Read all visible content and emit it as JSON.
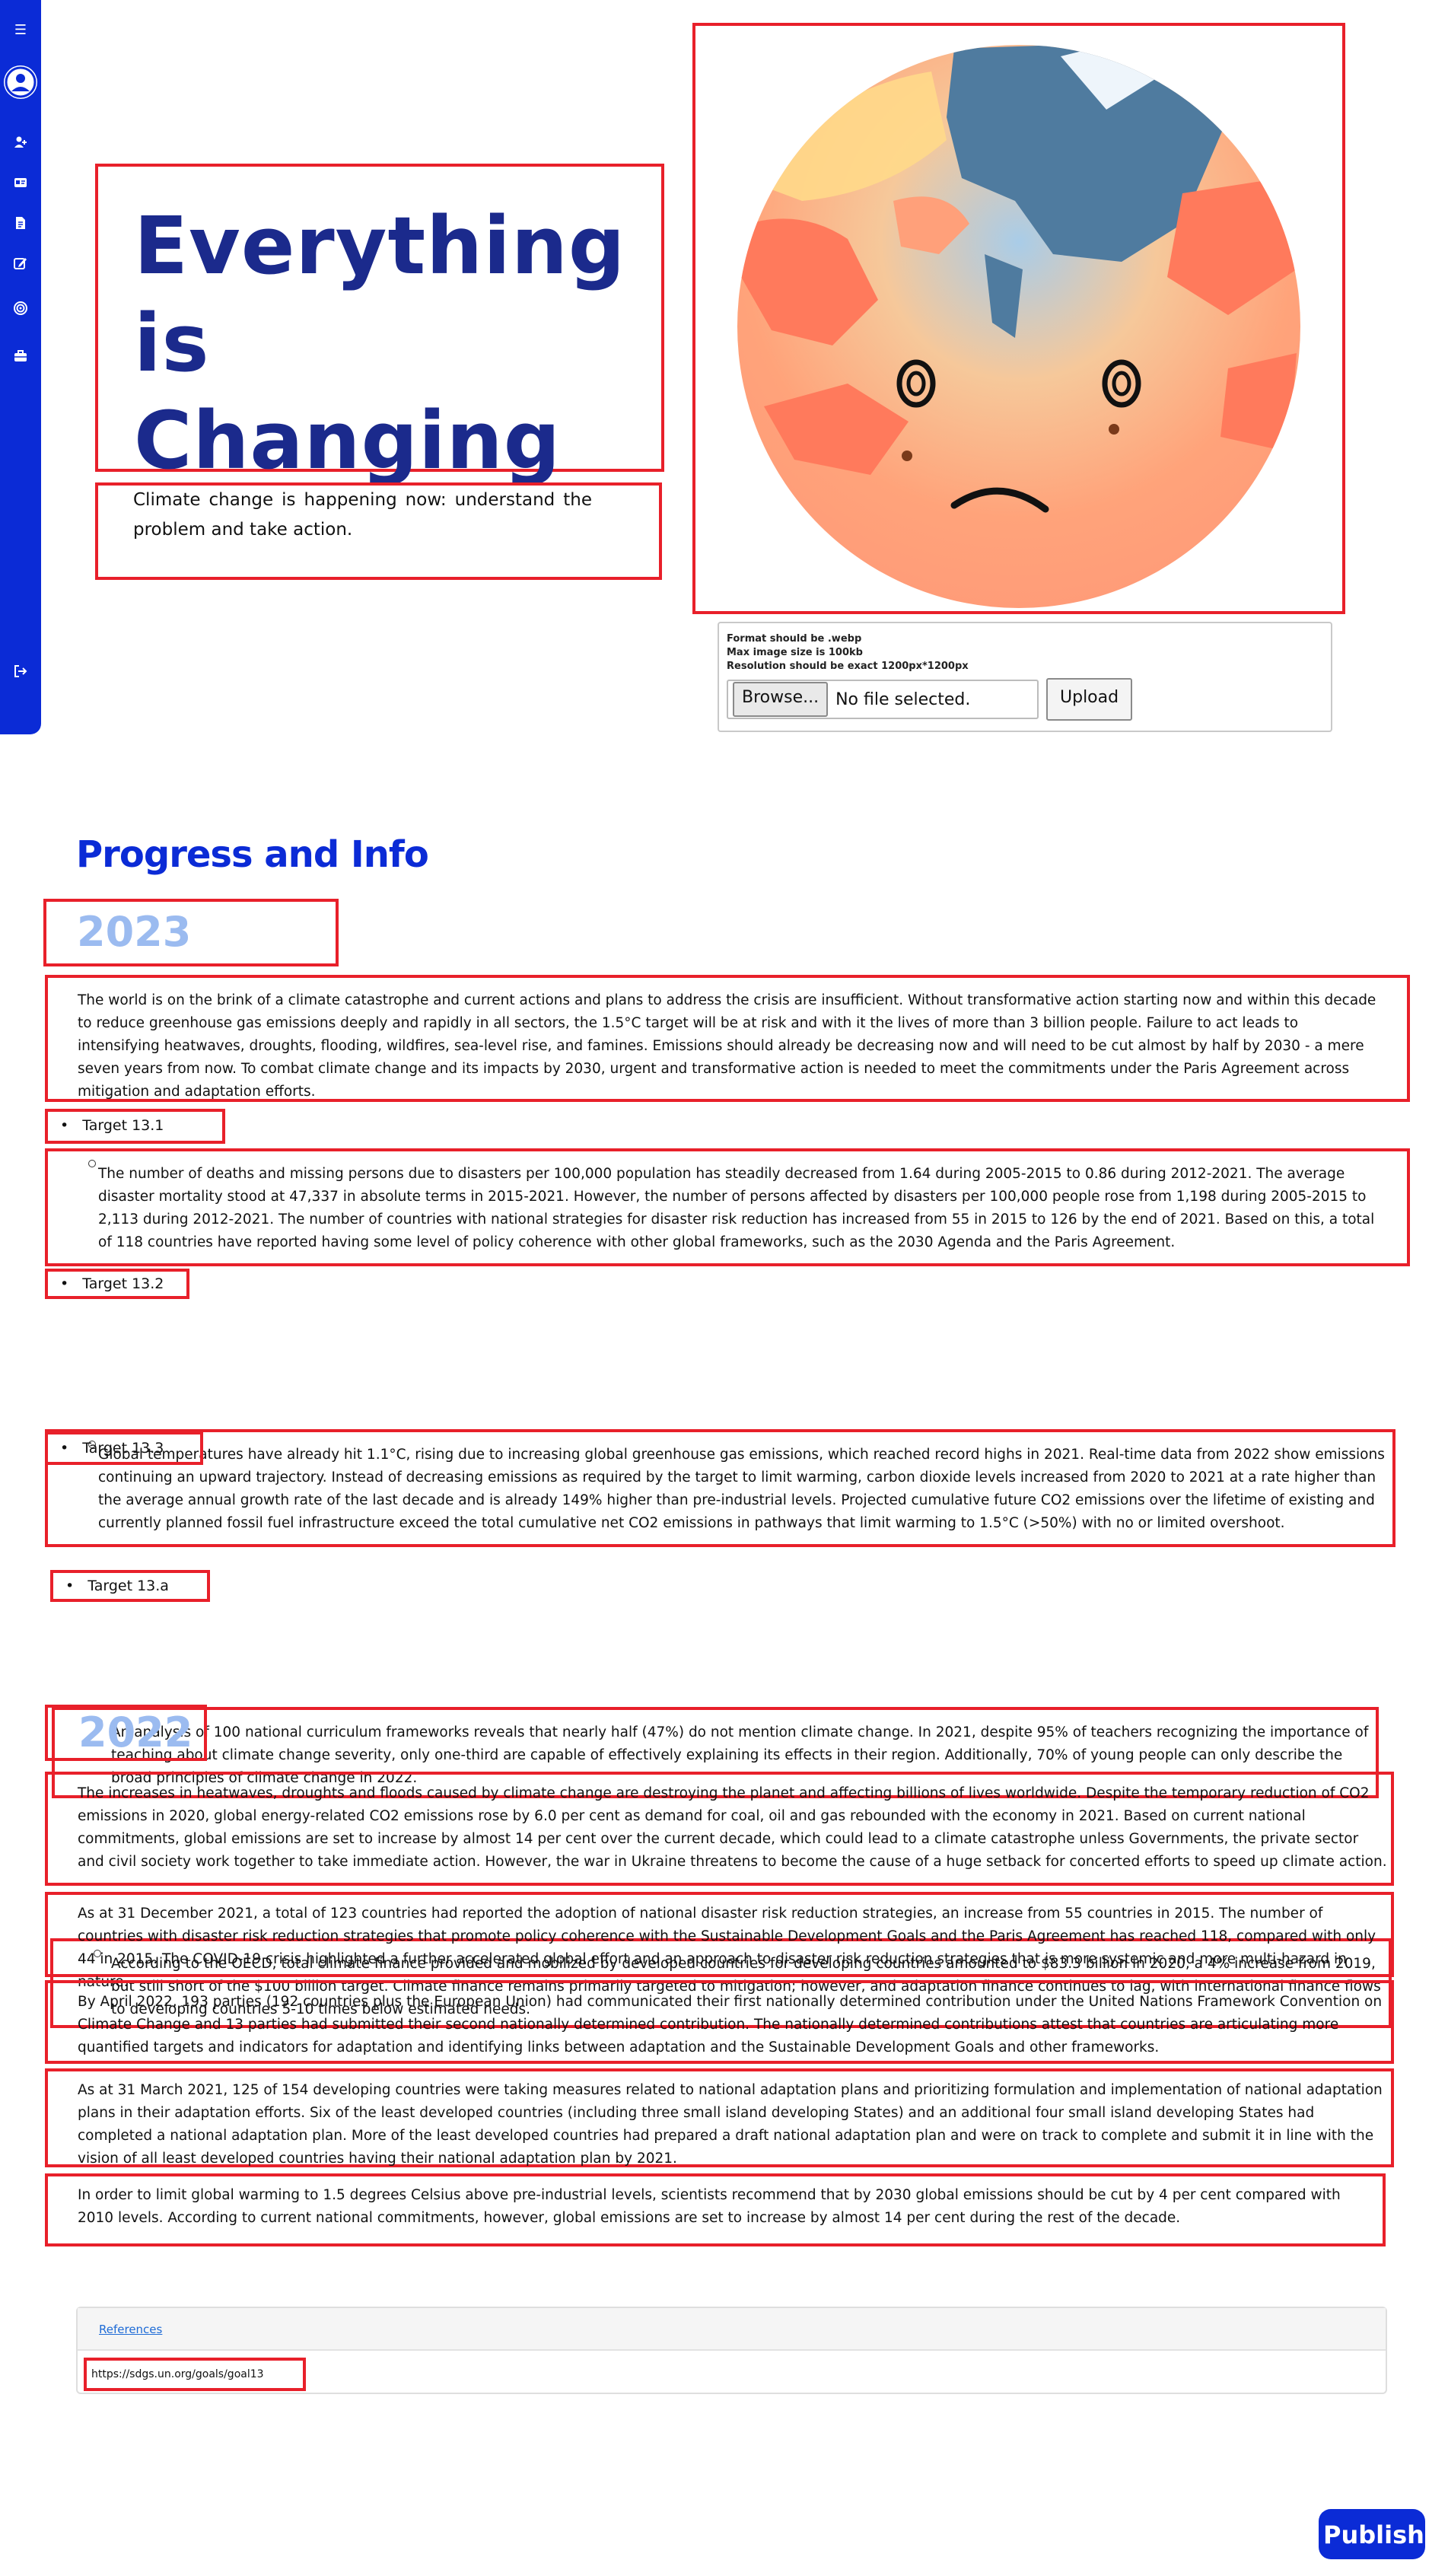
{
  "hero": {
    "title_lines": [
      "Everything",
      "is",
      "Changing"
    ],
    "subtitle": "Climate change is happening now: understand the problem and take action."
  },
  "upload": {
    "notes": [
      "Format should be .webp",
      "Max image size is 100kb",
      "Resolution should be exact 1200px*1200px"
    ],
    "browse_label": "Browse...",
    "file_status": "No file selected.",
    "upload_label": "Upload"
  },
  "sidebar": {
    "icons": [
      "menu-icon",
      "user-avatar-icon",
      "add-user-icon",
      "id-card-icon",
      "document-icon",
      "edit-icon",
      "target-icon",
      "briefcase-icon",
      "logout-icon"
    ]
  },
  "section": {
    "heading": "Progress and Info",
    "y2023": {
      "year": "2023",
      "intro": "The world is on the brink of a climate catastrophe and current actions and plans to address the crisis are insufficient. Without transformative action starting now and within this decade to reduce greenhouse gas emissions deeply and rapidly in all sectors, the 1.5°C target will be at risk and with it the lives of more than 3 billion people. Failure to act leads to intensifying heatwaves, droughts, flooding, wildfires, sea-level rise, and famines. Emissions should already be decreasing now and will need to be cut almost by half by 2030 - a mere seven years from now. To combat climate change and its impacts by 2030, urgent and transformative action is needed to meet the commitments under the Paris Agreement across mitigation and adaptation efforts.",
      "targets": [
        {
          "label": "Target 13.1",
          "text": "The number of deaths and missing persons due to disasters per 100,000 population has steadily decreased from 1.64 during 2005-2015 to 0.86 during 2012-2021. The average disaster mortality stood at 47,337 in absolute terms in 2015-2021. However, the number of persons affected by disasters per 100,000 people rose from 1,198 during 2005-2015 to 2,113 during 2012-2021. The number of countries with national strategies for disaster risk reduction has increased from 55 in 2015 to 126 by the end of 2021. Based on this, a total of 118 countries have reported having some level of policy coherence with other global frameworks, such as the 2030 Agenda and the Paris Agreement."
        },
        {
          "label": "Target 13.2",
          "text": "Global temperatures have already hit 1.1°C, rising due to increasing global greenhouse gas emissions, which reached record highs in 2021. Real-time data from 2022 show emissions continuing an upward trajectory. Instead of decreasing emissions as required by the target to limit warming, carbon dioxide levels increased from 2020 to 2021 at a rate higher than the average annual growth rate of the last decade and is already 149% higher than pre-industrial levels. Projected cumulative future CO2 emissions over the lifetime of existing and currently planned fossil fuel infrastructure exceed the total cumulative net CO2 emissions in pathways that limit warming to 1.5°C (>50%) with no or limited overshoot."
        },
        {
          "label": "Target 13.3",
          "text": "An analysis of 100 national curriculum frameworks reveals that nearly half (47%) do not mention climate change. In 2021, despite 95% of teachers recognizing the importance of teaching about climate change severity, only one-third are capable of effectively explaining its effects in their region. Additionally, 70% of young people can only describe the broad principles of climate change in 2022."
        },
        {
          "label": "Target 13.a",
          "text": "According to the OECD, total climate finance provided and mobilized by developed countries for developing countries amounted to $83.3 billion in 2020, a 4% increase from 2019, but still short of the $100 billion target. Climate finance remains primarily targeted to mitigation; however, and adaptation finance continues to lag, with international finance flows to developing countries 5-10 times below estimated needs."
        }
      ]
    },
    "y2022": {
      "year": "2022",
      "paragraphs": [
        "The increases in heatwaves, droughts and floods caused by climate change are destroying the planet and affecting billions of lives worldwide. Despite the temporary reduction of CO2 emissions in 2020, global energy-related CO2 emissions rose by 6.0 per cent as demand for coal, oil and gas rebounded with the economy in 2021. Based on current national commitments, global emissions are set to increase by almost 14 per cent over the current decade, which could lead to a climate catastrophe unless Governments, the private sector and civil society work together to take immediate action. However, the war in Ukraine threatens to become the cause of a huge setback for concerted efforts to speed up climate action.",
        "As at 31 December 2021, a total of 123 countries had reported the adoption of national disaster risk reduction strategies, an increase from 55 countries in 2015. The number of countries with disaster risk reduction strategies that promote policy coherence with the Sustainable Development Goals and the Paris Agreement has reached 118, compared with only 44 in 2015. The COVID-19 crisis highlighted a further accelerated global effort and an approach to disaster risk reduction strategies that is more systemic and more multi-hazard in nature.",
        "By April 2022, 193 parties (192 countries plus the European Union) had communicated their first nationally determined contribution under the United Nations Framework Convention on Climate Change and 13 parties had submitted their second nationally determined contribution. The nationally determined contributions attest that countries are articulating more quantified targets and indicators for adaptation and identifying links between adaptation and the Sustainable Development Goals and other frameworks.",
        "As at 31 March 2021, 125 of 154 developing countries were taking measures related to national adaptation plans and prioritizing formulation and implementation of national adaptation plans in their adaptation efforts. Six of the least developed countries (including three small island developing States) and an additional four small island developing States had completed a national adaptation plan. More of the least developed countries had prepared a draft national adaptation plan and were on track to complete and submit it in line with the vision of all least developed countries having their national adaptation plan by 2021.",
        "In order to limit global warming to 1.5 degrees Celsius above pre-industrial levels, scientists recommend that by 2030 global emissions should be cut by 4 per cent compared with 2010 levels. According to current national commitments, however, global emissions are set to increase by almost 14 per cent during the rest of the decade."
      ]
    }
  },
  "references": {
    "header": "References",
    "link": "https://sdgs.un.org/goals/goal13"
  },
  "publish_label": "Publish",
  "colors": {
    "brand_blue": "#0b2bd6",
    "title_navy": "#1b2a8c",
    "year_light_blue": "#9bbbf0",
    "highlight_red": "#e8202a"
  }
}
